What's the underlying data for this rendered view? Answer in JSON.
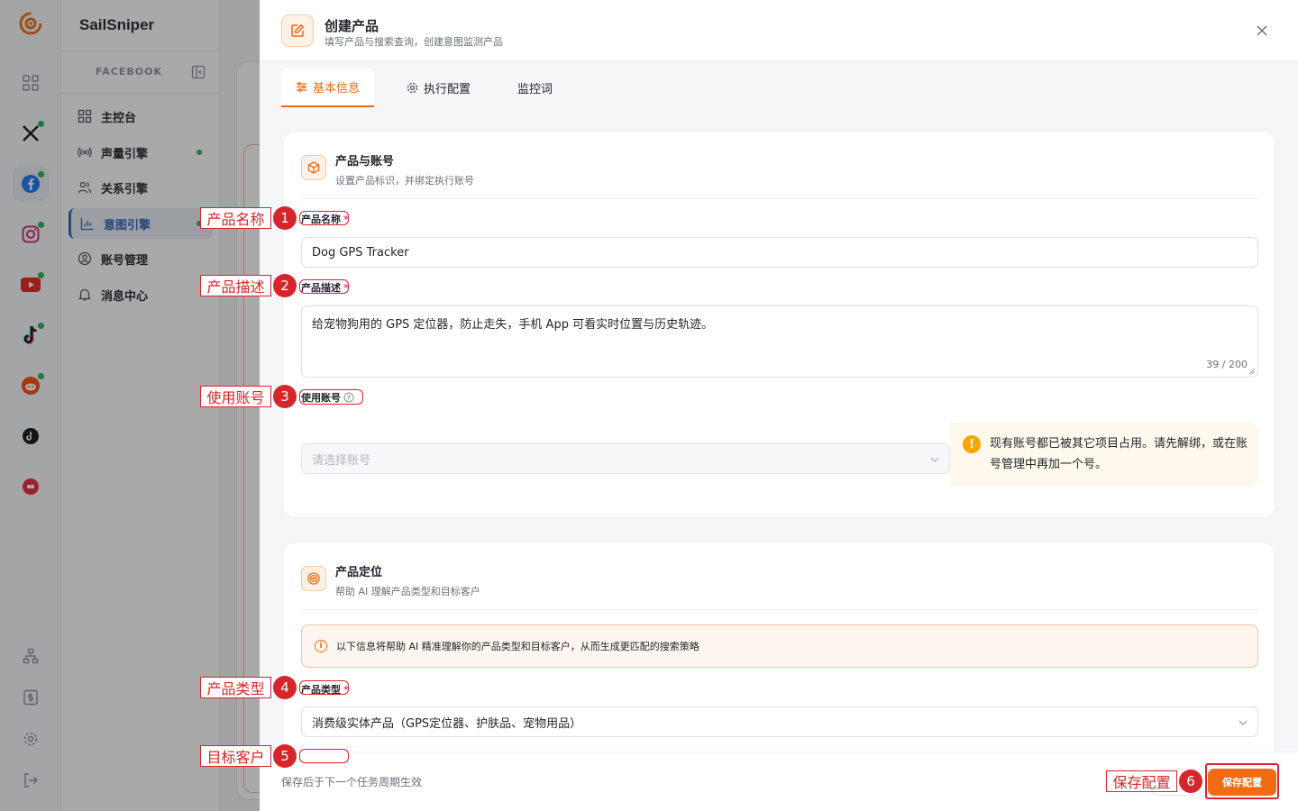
{
  "app": {
    "brand": "SailSniper",
    "section_label": "FACEBOOK"
  },
  "rail": {
    "items": [
      {
        "name": "dashboard-grid-icon",
        "status_dot": false
      },
      {
        "name": "x-twitter-icon",
        "status_dot": true
      },
      {
        "name": "facebook-icon",
        "status_dot": true,
        "active": true
      },
      {
        "name": "instagram-icon",
        "status_dot": true
      },
      {
        "name": "youtube-icon",
        "status_dot": true
      },
      {
        "name": "tiktok-icon",
        "status_dot": true
      },
      {
        "name": "reddit-icon",
        "status_dot": true
      },
      {
        "name": "threads-icon",
        "status_dot": false
      },
      {
        "name": "xiaohongshu-icon",
        "status_dot": false
      }
    ],
    "bottom": [
      "org-tree-icon",
      "billing-icon",
      "settings-gear-icon",
      "logout-icon"
    ]
  },
  "sidebar": {
    "items": [
      {
        "label": "主控台",
        "icon": "dashboard-icon"
      },
      {
        "label": "声量引擎",
        "icon": "broadcast-icon",
        "dot": true
      },
      {
        "label": "关系引擎",
        "icon": "users-icon"
      },
      {
        "label": "意图引擎",
        "icon": "bar-chart-icon",
        "active": true,
        "dot": true
      },
      {
        "label": "账号管理",
        "icon": "account-circle-icon"
      },
      {
        "label": "消息中心",
        "icon": "bell-icon"
      }
    ]
  },
  "drawer": {
    "title": "创建产品",
    "subtitle": "填写产品与搜索查询，创建意图监测产品",
    "tabs": [
      "基本信息",
      "执行配置",
      "监控词"
    ],
    "card1": {
      "title": "产品与账号",
      "subtitle": "设置产品标识，并绑定执行账号",
      "name_label": "产品名称",
      "name_value": "Dog GPS Tracker",
      "desc_label": "产品描述",
      "desc_value": "给宠物狗用的 GPS 定位器，防止走失，手机 App 可看实时位置与历史轨迹。",
      "desc_counter": "39 / 200",
      "account_label": "使用账号",
      "account_placeholder": "请选择账号",
      "warning_text": "现有账号都已被其它项目占用。请先解绑，或在账号管理中再加一个号。"
    },
    "card2": {
      "title": "产品定位",
      "subtitle": "帮助 AI 理解产品类型和目标客户",
      "info_text": "以下信息将帮助 AI 精准理解你的产品类型和目标客户，从而生成更匹配的搜索策略",
      "type_label": "产品类型",
      "type_value": "消费级实体产品（GPS定位器、护肤品、宠物用品）"
    },
    "footer_note": "保存后于下一个任务周期生效",
    "save_label": "保存配置"
  },
  "annotations": [
    {
      "n": "1",
      "label": "产品名称"
    },
    {
      "n": "2",
      "label": "产品描述"
    },
    {
      "n": "3",
      "label": "使用账号"
    },
    {
      "n": "4",
      "label": "产品类型"
    },
    {
      "n": "5",
      "label": "目标客户"
    },
    {
      "n": "6",
      "label": "保存配置"
    }
  ],
  "colors": {
    "accent": "#f06b13",
    "annotation": "#d6262b",
    "warning": "#f6a609",
    "status_green": "#22b15a",
    "nav_active": "#2f5fb3"
  }
}
